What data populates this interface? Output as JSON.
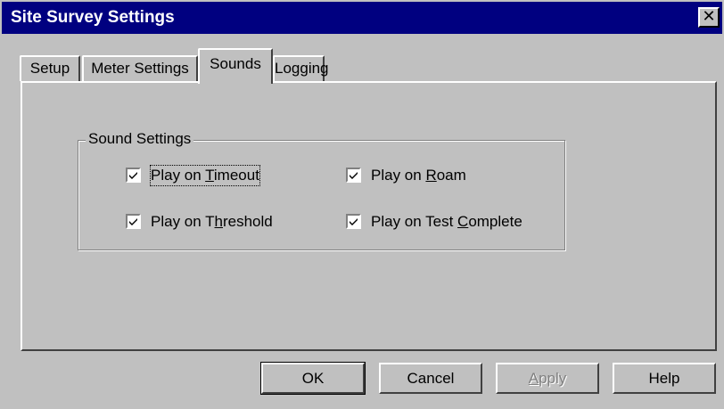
{
  "window": {
    "title": "Site Survey Settings",
    "close_glyph": "✕"
  },
  "tabs": [
    {
      "label": "Setup",
      "active": false
    },
    {
      "label": "Meter Settings",
      "active": false
    },
    {
      "label": "Sounds",
      "active": true
    },
    {
      "label": "Logging",
      "active": false
    }
  ],
  "sound_settings": {
    "legend": "Sound Settings",
    "options": [
      {
        "prefix": "Play on ",
        "mnemonic": "T",
        "suffix": "imeout",
        "checked": true
      },
      {
        "prefix": "Play on ",
        "mnemonic": "R",
        "suffix": "oam",
        "checked": true
      },
      {
        "prefix": "Play on T",
        "mnemonic": "h",
        "suffix": "reshold",
        "checked": true
      },
      {
        "prefix": "Play on Test ",
        "mnemonic": "C",
        "suffix": "omplete",
        "checked": true
      }
    ]
  },
  "buttons": {
    "ok": "OK",
    "cancel": "Cancel",
    "apply_mnemonic": "A",
    "apply_rest": "pply",
    "help": "Help"
  },
  "icons": {
    "close": "close-icon",
    "checkbox": "checkmark-icon"
  }
}
